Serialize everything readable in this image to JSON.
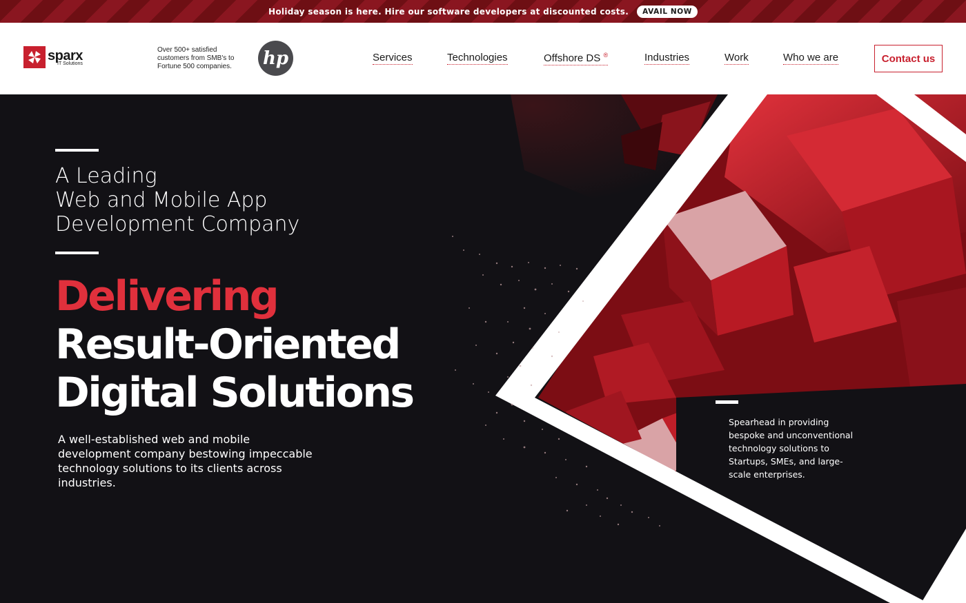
{
  "promo": {
    "text": "Holiday season is here. Hire our software developers at discounted costs.",
    "button": "AVAIL NOW"
  },
  "brand": {
    "name": "sparx",
    "sub": "IT Solutions",
    "logo_icon": "pinwheel-icon",
    "accent": "#c8202e"
  },
  "header": {
    "tagline": "Over 500+ satisfied customers from SMB's to Fortune 500 companies.",
    "client_logo": "hp"
  },
  "nav": {
    "items": [
      {
        "label": "Services"
      },
      {
        "label": "Technologies"
      },
      {
        "label": "Offshore DS",
        "sup": "®"
      },
      {
        "label": "Industries"
      },
      {
        "label": "Work"
      },
      {
        "label": "Who we are"
      }
    ],
    "contact": "Contact us"
  },
  "hero": {
    "lead_lines": [
      "A Leading",
      "Web and Mobile App",
      "Development Company"
    ],
    "headline_red": "Delivering",
    "headline_lines": [
      "Result-Oriented",
      "Digital Solutions"
    ],
    "description": "A well-established web and mobile development company bestowing impeccable technology solutions to its clients across industries.",
    "side_text": "Spearhead in providing bespoke and unconventional technology solutions to Startups, SMEs, and large-scale enterprises.",
    "colors": {
      "background": "#121115",
      "red": "#e0303c"
    }
  }
}
